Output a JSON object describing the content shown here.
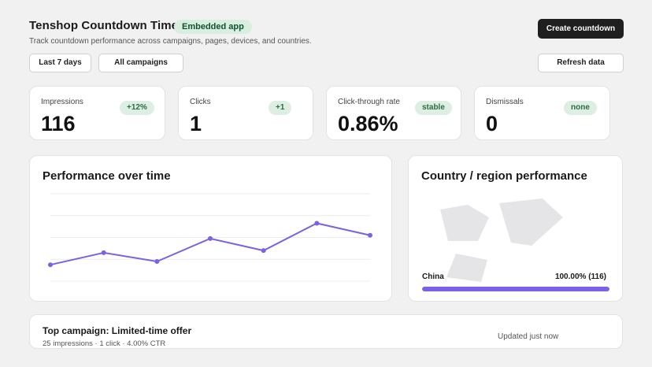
{
  "header": {
    "title": "Tenshop Countdown Timer",
    "badge": "Embedded app",
    "subtitle": "Track countdown performance across campaigns, pages, devices, and countries.",
    "create_button": "Create countdown"
  },
  "filters": {
    "range": "Last 7 days",
    "campaign": "All campaigns",
    "refresh": "Refresh data"
  },
  "stats": [
    {
      "label": "Impressions",
      "value": "116",
      "badge": "+12%"
    },
    {
      "label": "Clicks",
      "value": "1",
      "badge": "+1"
    },
    {
      "label": "Click-through rate",
      "value": "0.86%",
      "badge": "stable"
    },
    {
      "label": "Dismissals",
      "value": "0",
      "badge": "none"
    }
  ],
  "performance": {
    "title": "Performance over time",
    "chart_data": {
      "type": "line",
      "x": [
        1,
        2,
        3,
        4,
        5,
        6,
        7
      ],
      "series": [
        {
          "values": [
            15,
            26,
            18,
            39,
            28,
            53,
            42
          ]
        }
      ],
      "ylim": [
        0,
        80
      ],
      "grid": true,
      "color": "#7b61e6"
    }
  },
  "country": {
    "title": "Country / region performance",
    "name": "China",
    "value": "100.00% (116)",
    "share": 1.0,
    "bar_color": "#7b61e6"
  },
  "footer": {
    "title": "Top campaign: Limited-time offer",
    "subtitle": "25 impressions · 1 click · 4.00% CTR",
    "updated": "Updated just now"
  }
}
